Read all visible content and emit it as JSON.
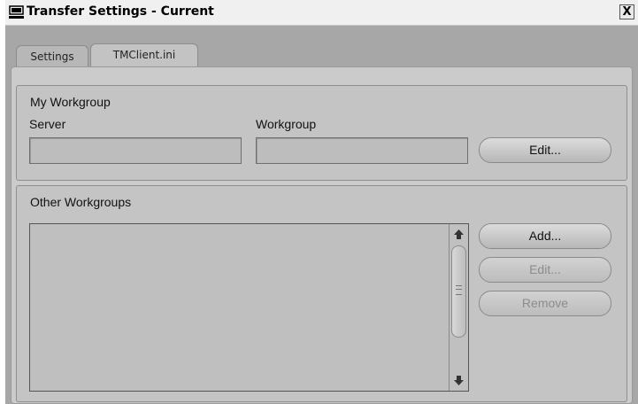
{
  "window": {
    "title": "Transfer Settings - Current",
    "close_label": "X"
  },
  "tabs": [
    {
      "label": "Settings"
    },
    {
      "label": "TMClient.ini"
    }
  ],
  "my_workgroup": {
    "heading": "My Workgroup",
    "server_label": "Server",
    "server_value": "",
    "workgroup_label": "Workgroup",
    "workgroup_value": "",
    "edit_label": "Edit..."
  },
  "other_workgroups": {
    "heading": "Other Workgroups",
    "items": [],
    "add_label": "Add...",
    "edit_label": "Edit...",
    "remove_label": "Remove"
  },
  "icons": {
    "title": "computer-icon",
    "scroll_up": "arrow-up-icon",
    "scroll_down": "arrow-down-icon",
    "thumb_grip": "grip-icon"
  }
}
